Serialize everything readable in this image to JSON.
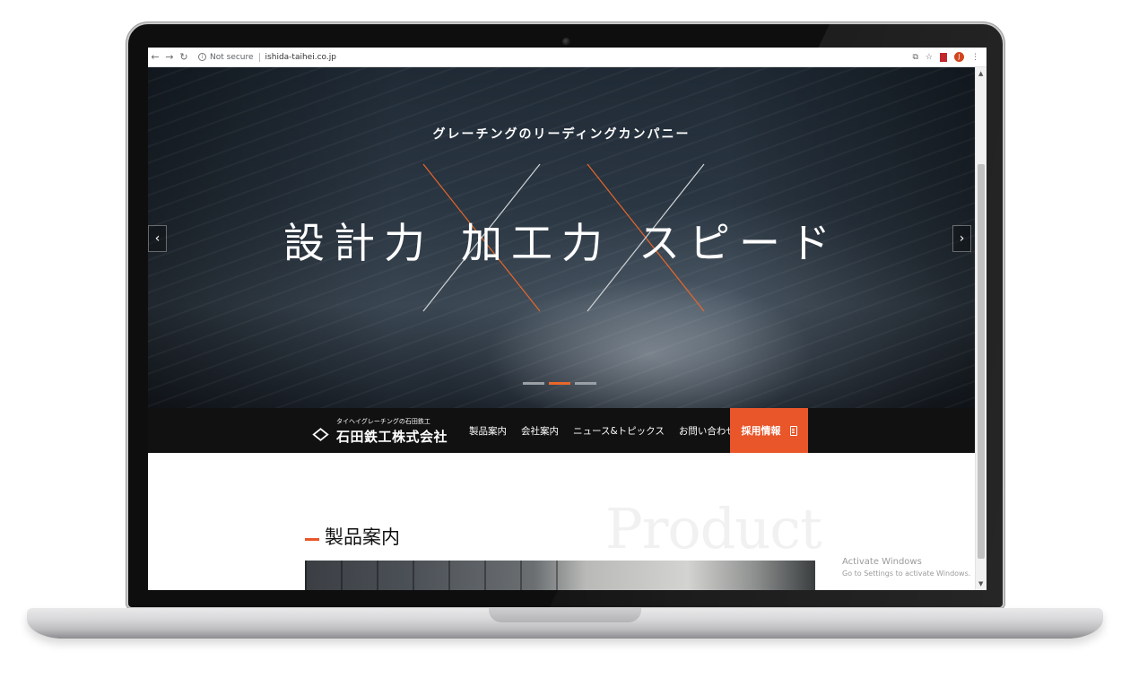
{
  "browser": {
    "security_label": "Not secure",
    "url": "ishida-taihei.co.jp",
    "avatar_initial": "J"
  },
  "hero": {
    "tagline": "グレーチングのリーディングカンパニー",
    "headline_words": [
      "設計力",
      "加工力",
      "スピード"
    ],
    "accent_color": "#e8672a",
    "active_slide": 2,
    "slide_count": 3
  },
  "nav": {
    "logo_subtitle": "タイヘイグレーチングの石田鉄工",
    "logo_name": "石田鉄工株式会社",
    "links": [
      "製品案内",
      "会社案内",
      "ニュース&トピックス",
      "お問い合わせ"
    ],
    "recruit_label": "採用情報",
    "recruit_color": "#e8562a"
  },
  "product": {
    "background_word": "Product",
    "title": "製品案内"
  },
  "watermark": {
    "title": "Activate Windows",
    "subtitle": "Go to Settings to activate Windows."
  }
}
